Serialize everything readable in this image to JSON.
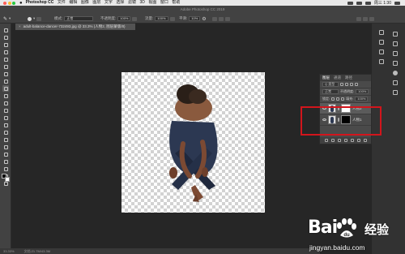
{
  "menubar": {
    "app": "Photoshop CC",
    "items": [
      "文件",
      "编辑",
      "图像",
      "图层",
      "文字",
      "选择",
      "滤镜",
      "3D",
      "视图",
      "窗口",
      "帮助"
    ],
    "clock": "周三 1:30"
  },
  "window": {
    "title": "Adobe Photoshop CC 2019"
  },
  "options": {
    "mode_label": "模式:",
    "mode_value": "正常",
    "opacity_label": "不透明度:",
    "opacity_value": "100%",
    "flow_label": "流量:",
    "flow_value": "100%",
    "smooth_label": "平滑:",
    "smooth_value": "10%"
  },
  "document": {
    "tab_label": "adult-balance-dancer-732493.jpg @ 33.3% (人物2, 图层蒙版/8)",
    "zoom": "33.33%",
    "info": "文档:21.7M/43.3M"
  },
  "layers_panel": {
    "tabs": [
      "图层",
      "通道",
      "路径"
    ],
    "filter_label": "Q 类型",
    "blend_mode": "正常",
    "opacity_label": "不透明度:",
    "opacity_value": "100%",
    "lock_label": "锁定:",
    "fill_label": "填充:",
    "fill_value": "100%",
    "layers": [
      {
        "name": "人物2"
      },
      {
        "name": "人物1"
      }
    ]
  },
  "watermark": {
    "logo": "Bai",
    "logo_cn": "经验",
    "url": "jingyan.baidu.com"
  },
  "colors": {
    "highlight": "#d2151c",
    "mac_close": "#fe5f57",
    "mac_min": "#febc2e",
    "mac_max": "#28c840"
  }
}
